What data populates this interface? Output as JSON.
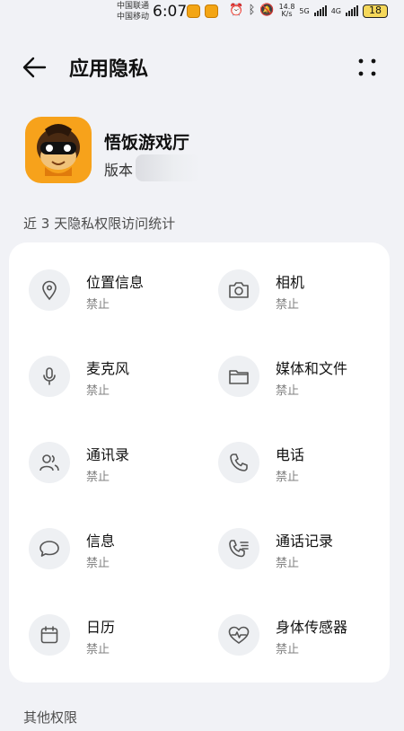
{
  "status_bar": {
    "carrier_1": "中国联通",
    "carrier_2": "中国移动",
    "time": "6:07",
    "net_speed_value": "14.8",
    "net_speed_unit": "K/s",
    "net_tag_1": "5G",
    "net_tag_2": "4G",
    "battery": "18"
  },
  "header": {
    "title": "应用隐私"
  },
  "app": {
    "name": "悟饭游戏厅",
    "version_label": "版本"
  },
  "sections": {
    "stats_title": "近 3 天隐私权限访问统计",
    "other_title": "其他权限"
  },
  "permissions": [
    {
      "name": "位置信息",
      "status": "禁止",
      "icon": "location-icon"
    },
    {
      "name": "相机",
      "status": "禁止",
      "icon": "camera-icon"
    },
    {
      "name": "麦克风",
      "status": "禁止",
      "icon": "microphone-icon"
    },
    {
      "name": "媒体和文件",
      "status": "禁止",
      "icon": "folder-icon"
    },
    {
      "name": "通讯录",
      "status": "禁止",
      "icon": "contacts-icon"
    },
    {
      "name": "电话",
      "status": "禁止",
      "icon": "phone-icon"
    },
    {
      "name": "信息",
      "status": "禁止",
      "icon": "message-icon"
    },
    {
      "name": "通话记录",
      "status": "禁止",
      "icon": "call-log-icon"
    },
    {
      "name": "日历",
      "status": "禁止",
      "icon": "calendar-icon"
    },
    {
      "name": "身体传感器",
      "status": "禁止",
      "icon": "heart-sensor-icon"
    }
  ],
  "colors": {
    "background": "#f1f2f6",
    "card": "#ffffff",
    "icon_circle": "#eef0f3",
    "icon_stroke": "#555555",
    "app_icon_orange": "#f7a21b"
  }
}
